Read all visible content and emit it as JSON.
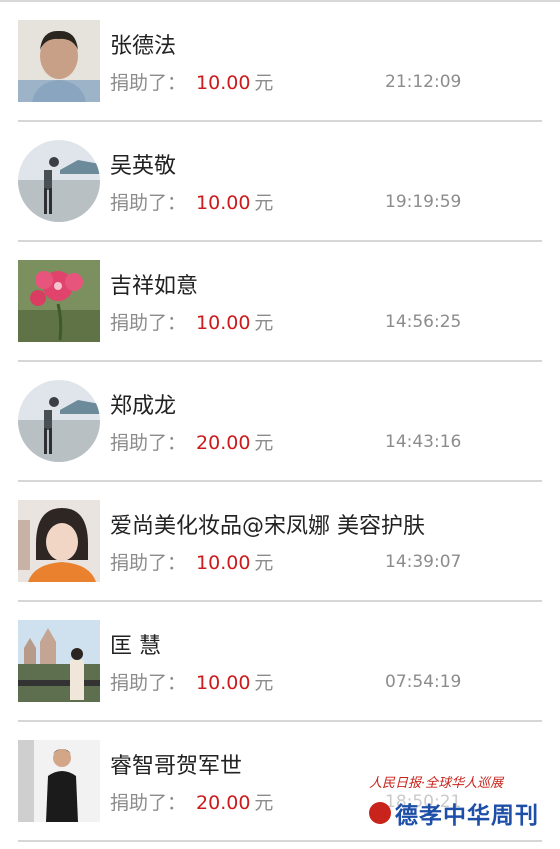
{
  "donations": [
    {
      "name": "张德法",
      "label": "捐助了：",
      "amount": "10.00",
      "unit": "元",
      "time": "21:12:09",
      "avatar_icon": "portrait-photo"
    },
    {
      "name": "吴英敬",
      "label": "捐助了：",
      "amount": "10.00",
      "unit": "元",
      "time": "19:19:59",
      "avatar_icon": "default-avatar-photo"
    },
    {
      "name": "吉祥如意",
      "label": "捐助了：",
      "amount": "10.00",
      "unit": "元",
      "time": "14:56:25",
      "avatar_icon": "flower-photo"
    },
    {
      "name": "郑成龙",
      "label": "捐助了：",
      "amount": "20.00",
      "unit": "元",
      "time": "14:43:16",
      "avatar_icon": "default-avatar-photo"
    },
    {
      "name": "爱尚美化妆品@宋凤娜 美容护肤",
      "label": "捐助了：",
      "amount": "10.00",
      "unit": "元",
      "time": "14:39:07",
      "avatar_icon": "woman-portrait-photo"
    },
    {
      "name": "匡 慧",
      "label": "捐助了：",
      "amount": "10.00",
      "unit": "元",
      "time": "07:54:19",
      "avatar_icon": "castle-photo"
    },
    {
      "name": "睿智哥贺军世",
      "label": "捐助了：",
      "amount": "20.00",
      "unit": "元",
      "time": "18:50:21",
      "avatar_icon": "man-standing-photo"
    }
  ],
  "watermark": {
    "top_text": "人民日报·全球华人巡展",
    "main_text": "德孝中华周刊"
  },
  "colors": {
    "amount": "#cc1b1b",
    "text_gray": "#8c8c8c",
    "divider": "#d6d6d6",
    "brand_blue": "#1e4fa8"
  }
}
